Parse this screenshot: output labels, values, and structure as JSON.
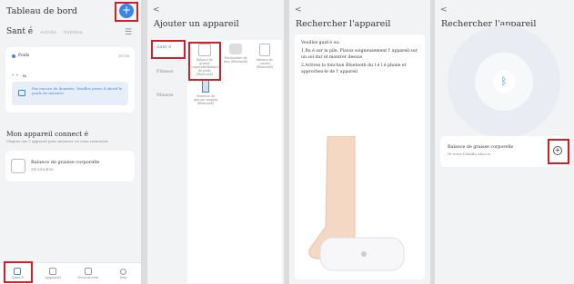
{
  "p1": {
    "title": "Tableau de bord",
    "tabs": [
      "Sant é",
      "Activité",
      "Nutrition"
    ],
    "weight_card": {
      "label": "Poids",
      "date": "07/18",
      "value": "- -",
      "unit": "lb",
      "hint": "Pas encore de données. Veuillez peser d abord le poids de mesurer"
    },
    "section_title": "Mon appareil connect é",
    "section_sub": "Cliquez sur l' appareil pour mesurer ou vous connecter",
    "device": {
      "name": "Balance de graisse corporelle",
      "id": "ZR-SZ6/R98"
    },
    "nav": [
      "Sant é",
      "Appareil",
      "Découverte",
      "Moi"
    ]
  },
  "p2": {
    "back": "<",
    "title": "Ajouter un appareil",
    "categories": [
      "Sant é",
      "Fitness",
      "Maison"
    ],
    "devices": [
      "Balance de graisse corporelle(Balance de poids (Bluetooth)",
      "Tensiomètre du bras (Bluetooth)",
      "Balance de cuisine (Bluetooth)"
    ],
    "device4": "Moniteur de glucose sanguin (Bluetooth)"
  },
  "p3": {
    "back": "<",
    "title": "Rechercher l'appareil",
    "instructions_title": "Veuillez guid é ou:",
    "instructions": [
      "1.Bu é sur la pile. Placez soigneusement l' appareil sur un sol dur et montrer dessus",
      "2.Activez la fonction Bluetooth du t é l é phone et approchez-le de l' appareil"
    ]
  },
  "p4": {
    "back": "<",
    "title": "Rechercher l'appareil",
    "found": {
      "name": "Balance de graisse corporelle",
      "id": "Ib www.t2hiaila.nhn.cn"
    }
  },
  "colors": {
    "accent": "#3b86e0",
    "highlight": "#d0202a"
  }
}
